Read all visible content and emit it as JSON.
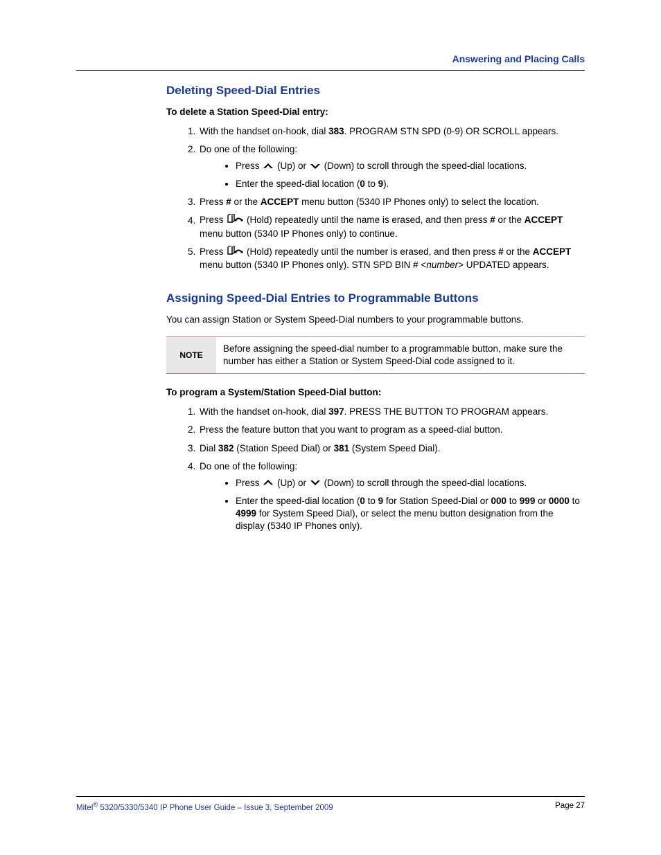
{
  "header": {
    "section_title": "Answering and Placing Calls"
  },
  "section1": {
    "heading": "Deleting Speed-Dial Entries",
    "intro": "To delete a Station Speed-Dial entry:",
    "step1_a": "With the handset on-hook, dial ",
    "step1_code": "383",
    "step1_b": ". PROGRAM STN SPD (0-9) OR SCROLL appears.",
    "step2": "Do one of the following:",
    "step2_bullet1_a": "Press ",
    "step2_bullet1_b": " (Up) or ",
    "step2_bullet1_c": " (Down) to scroll through the speed-dial locations.",
    "step2_bullet2_a": "Enter the speed-dial location (",
    "step2_bullet2_zero": "0",
    "step2_bullet2_to": " to ",
    "step2_bullet2_nine": "9",
    "step2_bullet2_b": ").",
    "step3_a": "Press ",
    "step3_hash": "#",
    "step3_b": " or the ",
    "step3_accept": "ACCEPT",
    "step3_c": " menu button (5340 IP Phones only) to select the location.",
    "step4_a": "Press ",
    "step4_b": " (Hold) repeatedly until the name is erased, and then press ",
    "step4_hash": "#",
    "step4_c": " or the ",
    "step4_accept": "ACCEPT",
    "step4_d": " menu button (5340 IP Phones only) to continue.",
    "step5_a": "Press ",
    "step5_b": " (Hold) repeatedly until the number is erased, and then press ",
    "step5_hash": "#",
    "step5_c": " or the ",
    "step5_accept": "ACCEPT",
    "step5_d": " menu button (5340 IP Phones only). STN SPD BIN # <",
    "step5_number": "number",
    "step5_e": "> UPDATED appears."
  },
  "section2": {
    "heading": "Assigning Speed-Dial Entries to Programmable Buttons",
    "para": "You can assign Station or System Speed-Dial numbers to your programmable buttons.",
    "note_label": "NOTE",
    "note_text": "Before assigning the speed-dial number to a programmable button, make sure the number has either a Station or System Speed-Dial code assigned to it.",
    "intro": "To program a System/Station Speed-Dial button:",
    "step1_a": "With the handset on-hook, dial ",
    "step1_code": "397",
    "step1_b": ". PRESS THE BUTTON TO PROGRAM appears.",
    "step2": "Press the feature button that you want to program as a speed-dial button.",
    "step3_a": "Dial ",
    "step3_code1": "382",
    "step3_b": " (Station Speed Dial) or ",
    "step3_code2": "381",
    "step3_c": " (System Speed Dial).",
    "step4": "Do one of the following:",
    "step4_bullet1_a": "Press ",
    "step4_bullet1_b": " (Up) or ",
    "step4_bullet1_c": " (Down) to scroll through the speed-dial locations.",
    "step4_bullet2_a": "Enter the speed-dial location (",
    "step4_bullet2_zero": "0",
    "step4_bullet2_to1": " to ",
    "step4_bullet2_nine": "9",
    "step4_bullet2_b": " for Station Speed-Dial or ",
    "step4_bullet2_000": "000",
    "step4_bullet2_to2": " to ",
    "step4_bullet2_999": "999",
    "step4_bullet2_or": " or ",
    "step4_bullet2_0000": "0000",
    "step4_bullet2_to3": " to ",
    "step4_bullet2_4999": "4999",
    "step4_bullet2_c": " for System Speed Dial), or select the menu button designation from the display (5340 IP Phones only)."
  },
  "footer": {
    "left_a": "Mitel",
    "left_b": " 5320/5330/5340 IP Phone User Guide  – Issue 3, September 2009",
    "right": "Page 27"
  }
}
